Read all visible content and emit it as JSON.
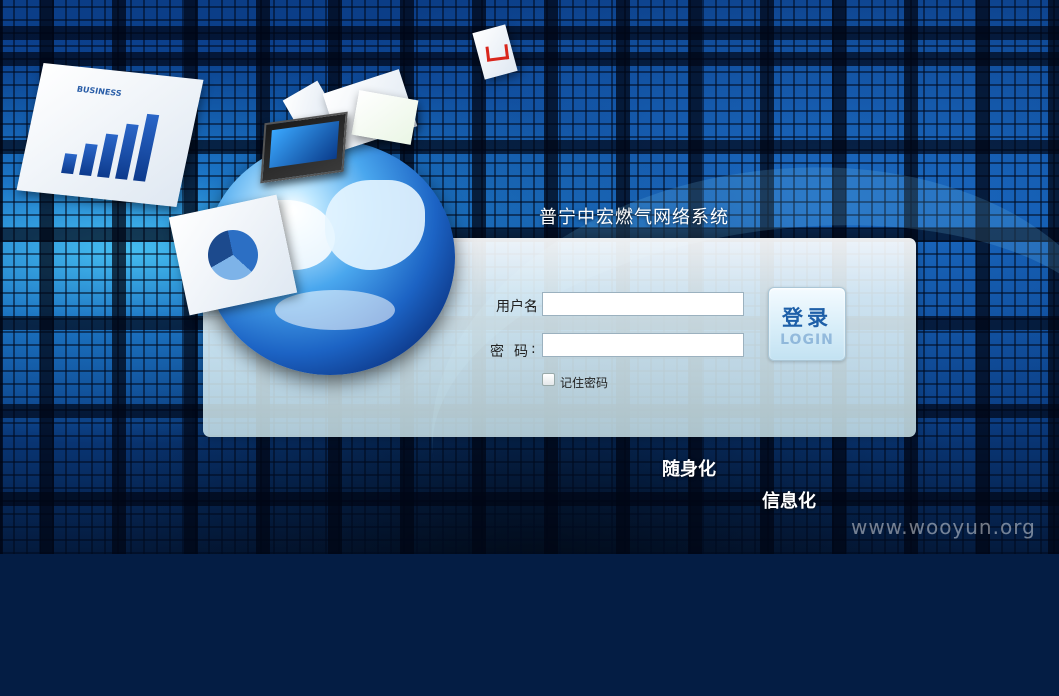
{
  "header": {
    "system_title": "普宁中宏燃气网络系统"
  },
  "login_form": {
    "username_label": "用户名",
    "password_label": "密码",
    "colon": ":",
    "username_value": "",
    "password_value": "",
    "remember_label": "记住密码",
    "remember_checked": false,
    "login_button_cn": "登录",
    "login_button_en": "LOGIN"
  },
  "decor": {
    "paper_label": "BUSINESS"
  },
  "slogans": [
    "随身化",
    "信息化"
  ],
  "watermark": "www.wooyun.org",
  "colors": {
    "accent": "#1d5fa8",
    "background": "#0d4fa3",
    "panel": "#e6f5fa"
  }
}
